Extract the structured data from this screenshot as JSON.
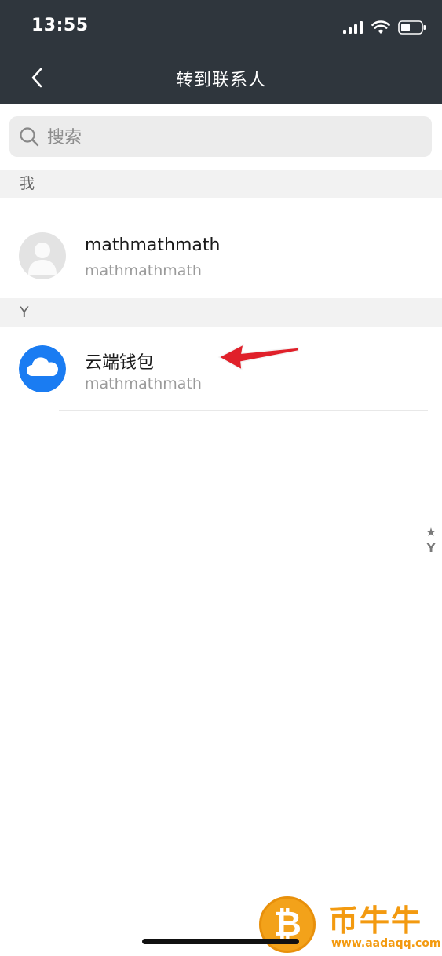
{
  "status_bar": {
    "time": "13:55"
  },
  "nav": {
    "title": "转到联系人"
  },
  "search": {
    "placeholder": "搜索"
  },
  "sections": [
    {
      "header": "我",
      "contacts": [
        {
          "name": "mathmathmath",
          "subtitle": "mathmathmath",
          "avatar": "default-person-avatar"
        }
      ]
    },
    {
      "header": "Y",
      "contacts": [
        {
          "name": "云端钱包",
          "subtitle": "mathmathmath",
          "avatar": "cloud-avatar",
          "avatar_color": "#1a7cf2"
        }
      ]
    }
  ],
  "index_bar": {
    "items": [
      "★",
      "Y"
    ]
  },
  "annotation": {
    "type": "red-arrow",
    "color": "#e0202a"
  },
  "watermark": {
    "coin": "₿",
    "brand": "币牛牛",
    "url": "www.aadaqq.com"
  }
}
